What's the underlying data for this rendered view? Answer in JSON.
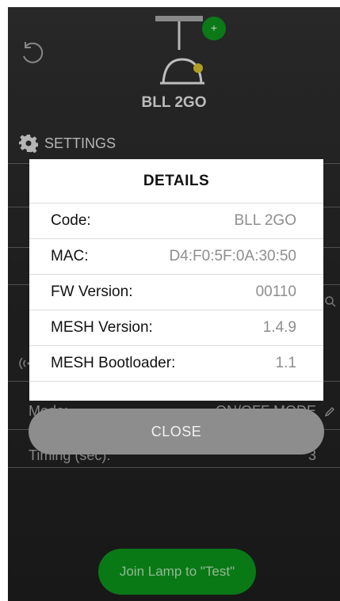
{
  "device": {
    "name": "BLL 2GO"
  },
  "settings": {
    "label": "SETTINGS"
  },
  "background_rows": {
    "mode_label": "Mode:",
    "mode_value": "ON/OFF MODE",
    "timing_label": "Timing (sec):",
    "timing_value": "3"
  },
  "details": {
    "title": "DETAILS",
    "rows": [
      {
        "label": "Code:",
        "value": "BLL 2GO"
      },
      {
        "label": "MAC:",
        "value": "D4:F0:5F:0A:30:50"
      },
      {
        "label": "FW Version:",
        "value": "00110"
      },
      {
        "label": "MESH Version:",
        "value": "1.4.9"
      },
      {
        "label": "MESH Bootloader:",
        "value": "1.1"
      }
    ]
  },
  "close_button": {
    "label": "CLOSE"
  },
  "join_button": {
    "label": "Join Lamp to \"Test\""
  },
  "add_badge": {
    "label": "+"
  },
  "colors": {
    "accent_green": "#0b8a1a",
    "close_gray": "#8d8d8d",
    "background": "#262626"
  },
  "icons": [
    "refresh-icon",
    "lamp-icon",
    "gear-icon",
    "search-icon",
    "signal-icon",
    "pencil-icon"
  ]
}
